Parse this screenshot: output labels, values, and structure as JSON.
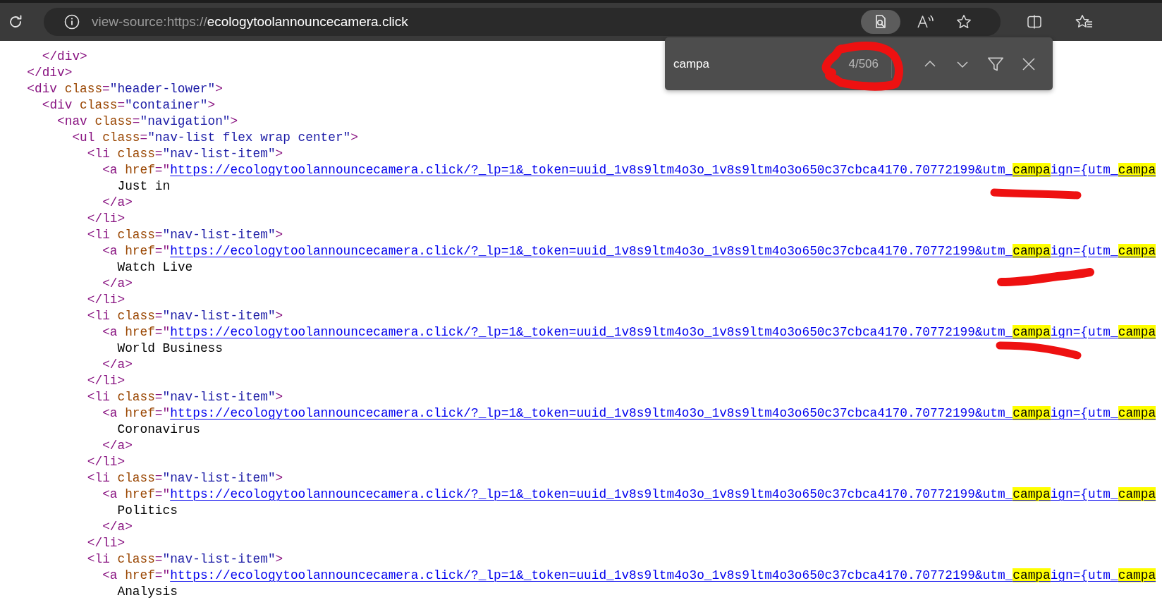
{
  "toolbar": {
    "address": {
      "scheme": "view-source:https://",
      "domain": "ecologytoolannouncecamera.click"
    },
    "find_button_active": true
  },
  "find_bar": {
    "query": "campa",
    "count": "4/506"
  },
  "source_lines": [
    {
      "children": [
        {
          "tokens": [
            {
              "kind": "tag",
              "text": "</div>"
            }
          ]
        }
      ]
    },
    {
      "tokens": [
        {
          "kind": "tag",
          "text": "</div>"
        }
      ]
    },
    {
      "tokens": [
        {
          "kind": "tag",
          "text": "<div "
        },
        {
          "kind": "attr",
          "text": "class"
        },
        {
          "kind": "tag",
          "text": "="
        },
        {
          "kind": "value",
          "text": "\"header-lower\""
        },
        {
          "kind": "tag",
          "text": ">"
        }
      ],
      "children": [
        {
          "tokens": [
            {
              "kind": "tag",
              "text": "<div "
            },
            {
              "kind": "attr",
              "text": "class"
            },
            {
              "kind": "tag",
              "text": "="
            },
            {
              "kind": "value",
              "text": "\"container\""
            },
            {
              "kind": "tag",
              "text": ">"
            }
          ],
          "children": [
            {
              "tokens": [
                {
                  "kind": "tag",
                  "text": "<nav "
                },
                {
                  "kind": "attr",
                  "text": "class"
                },
                {
                  "kind": "tag",
                  "text": "="
                },
                {
                  "kind": "value",
                  "text": "\"navigation\""
                },
                {
                  "kind": "tag",
                  "text": ">"
                }
              ],
              "children": [
                {
                  "tokens": [
                    {
                      "kind": "tag",
                      "text": "<ul "
                    },
                    {
                      "kind": "attr",
                      "text": "class"
                    },
                    {
                      "kind": "tag",
                      "text": "="
                    },
                    {
                      "kind": "value",
                      "text": "\"nav-list flex wrap center\""
                    },
                    {
                      "kind": "tag",
                      "text": ">"
                    }
                  ],
                  "children": [
                    {
                      "tokens": [
                        {
                          "kind": "tag",
                          "text": "<li "
                        },
                        {
                          "kind": "attr",
                          "text": "class"
                        },
                        {
                          "kind": "tag",
                          "text": "="
                        },
                        {
                          "kind": "value",
                          "text": "\"nav-list-item\""
                        },
                        {
                          "kind": "tag",
                          "text": ">"
                        }
                      ],
                      "children": [
                        {
                          "tokens": [
                            {
                              "kind": "tag",
                              "text": "<a "
                            },
                            {
                              "kind": "attr",
                              "text": "href"
                            },
                            {
                              "kind": "tag",
                              "text": "=\""
                            }
                          ],
                          "link": [
                            {
                              "text": "https://ecologytoolannouncecamera.click/?_lp=1&_token=uuid_1v8s9ltm4o3o_1v8s9ltm4o3o650c37cbca4170.70772199&utm_",
                              "match": false
                            },
                            {
                              "text": "campa",
                              "match": true
                            },
                            {
                              "text": "ign={utm_",
                              "match": false
                            },
                            {
                              "text": "campa",
                              "match": true
                            }
                          ],
                          "children": [
                            {
                              "tokens": [
                                {
                                  "kind": "text",
                                  "text": "Just in"
                                }
                              ]
                            }
                          ]
                        },
                        {
                          "tokens": [
                            {
                              "kind": "tag",
                              "text": "</a>"
                            }
                          ]
                        }
                      ]
                    },
                    {
                      "tokens": [
                        {
                          "kind": "tag",
                          "text": "</li>"
                        }
                      ]
                    },
                    {
                      "tokens": [
                        {
                          "kind": "tag",
                          "text": "<li "
                        },
                        {
                          "kind": "attr",
                          "text": "class"
                        },
                        {
                          "kind": "tag",
                          "text": "="
                        },
                        {
                          "kind": "value",
                          "text": "\"nav-list-item\""
                        },
                        {
                          "kind": "tag",
                          "text": ">"
                        }
                      ],
                      "children": [
                        {
                          "tokens": [
                            {
                              "kind": "tag",
                              "text": "<a "
                            },
                            {
                              "kind": "attr",
                              "text": "href"
                            },
                            {
                              "kind": "tag",
                              "text": "=\""
                            }
                          ],
                          "link": [
                            {
                              "text": "https://ecologytoolannouncecamera.click/?_lp=1&_token=uuid_1v8s9ltm4o3o_1v8s9ltm4o3o650c37cbca4170.70772199&utm_",
                              "match": false
                            },
                            {
                              "text": "campa",
                              "match": true
                            },
                            {
                              "text": "ign={utm_",
                              "match": false
                            },
                            {
                              "text": "campa",
                              "match": true
                            }
                          ],
                          "children": [
                            {
                              "tokens": [
                                {
                                  "kind": "text",
                                  "text": "Watch Live"
                                }
                              ]
                            }
                          ]
                        },
                        {
                          "tokens": [
                            {
                              "kind": "tag",
                              "text": "</a>"
                            }
                          ]
                        }
                      ]
                    },
                    {
                      "tokens": [
                        {
                          "kind": "tag",
                          "text": "</li>"
                        }
                      ]
                    },
                    {
                      "tokens": [
                        {
                          "kind": "tag",
                          "text": "<li "
                        },
                        {
                          "kind": "attr",
                          "text": "class"
                        },
                        {
                          "kind": "tag",
                          "text": "="
                        },
                        {
                          "kind": "value",
                          "text": "\"nav-list-item\""
                        },
                        {
                          "kind": "tag",
                          "text": ">"
                        }
                      ],
                      "children": [
                        {
                          "tokens": [
                            {
                              "kind": "tag",
                              "text": "<a "
                            },
                            {
                              "kind": "attr",
                              "text": "href"
                            },
                            {
                              "kind": "tag",
                              "text": "=\""
                            }
                          ],
                          "link": [
                            {
                              "text": "https://ecologytoolannouncecamera.click/?_lp=1&_token=uuid_1v8s9ltm4o3o_1v8s9ltm4o3o650c37cbca4170.70772199&utm_",
                              "match": false
                            },
                            {
                              "text": "campa",
                              "match": true
                            },
                            {
                              "text": "ign={utm_",
                              "match": false
                            },
                            {
                              "text": "campa",
                              "match": true
                            }
                          ],
                          "children": [
                            {
                              "tokens": [
                                {
                                  "kind": "text",
                                  "text": "World Business"
                                }
                              ]
                            }
                          ]
                        },
                        {
                          "tokens": [
                            {
                              "kind": "tag",
                              "text": "</a>"
                            }
                          ]
                        }
                      ]
                    },
                    {
                      "tokens": [
                        {
                          "kind": "tag",
                          "text": "</li>"
                        }
                      ]
                    },
                    {
                      "tokens": [
                        {
                          "kind": "tag",
                          "text": "<li "
                        },
                        {
                          "kind": "attr",
                          "text": "class"
                        },
                        {
                          "kind": "tag",
                          "text": "="
                        },
                        {
                          "kind": "value",
                          "text": "\"nav-list-item\""
                        },
                        {
                          "kind": "tag",
                          "text": ">"
                        }
                      ],
                      "children": [
                        {
                          "tokens": [
                            {
                              "kind": "tag",
                              "text": "<a "
                            },
                            {
                              "kind": "attr",
                              "text": "href"
                            },
                            {
                              "kind": "tag",
                              "text": "=\""
                            }
                          ],
                          "link": [
                            {
                              "text": "https://ecologytoolannouncecamera.click/?_lp=1&_token=uuid_1v8s9ltm4o3o_1v8s9ltm4o3o650c37cbca4170.70772199&utm_",
                              "match": false
                            },
                            {
                              "text": "campa",
                              "match": true
                            },
                            {
                              "text": "ign={utm_",
                              "match": false
                            },
                            {
                              "text": "campa",
                              "match": true
                            }
                          ],
                          "children": [
                            {
                              "tokens": [
                                {
                                  "kind": "text",
                                  "text": "Coronavirus"
                                }
                              ]
                            }
                          ]
                        },
                        {
                          "tokens": [
                            {
                              "kind": "tag",
                              "text": "</a>"
                            }
                          ]
                        }
                      ]
                    },
                    {
                      "tokens": [
                        {
                          "kind": "tag",
                          "text": "</li>"
                        }
                      ]
                    },
                    {
                      "tokens": [
                        {
                          "kind": "tag",
                          "text": "<li "
                        },
                        {
                          "kind": "attr",
                          "text": "class"
                        },
                        {
                          "kind": "tag",
                          "text": "="
                        },
                        {
                          "kind": "value",
                          "text": "\"nav-list-item\""
                        },
                        {
                          "kind": "tag",
                          "text": ">"
                        }
                      ],
                      "children": [
                        {
                          "tokens": [
                            {
                              "kind": "tag",
                              "text": "<a "
                            },
                            {
                              "kind": "attr",
                              "text": "href"
                            },
                            {
                              "kind": "tag",
                              "text": "=\""
                            }
                          ],
                          "link": [
                            {
                              "text": "https://ecologytoolannouncecamera.click/?_lp=1&_token=uuid_1v8s9ltm4o3o_1v8s9ltm4o3o650c37cbca4170.70772199&utm_",
                              "match": false
                            },
                            {
                              "text": "campa",
                              "match": true
                            },
                            {
                              "text": "ign={utm_",
                              "match": false
                            },
                            {
                              "text": "campa",
                              "match": true
                            }
                          ],
                          "children": [
                            {
                              "tokens": [
                                {
                                  "kind": "text",
                                  "text": "Politics"
                                }
                              ]
                            }
                          ]
                        },
                        {
                          "tokens": [
                            {
                              "kind": "tag",
                              "text": "</a>"
                            }
                          ]
                        }
                      ]
                    },
                    {
                      "tokens": [
                        {
                          "kind": "tag",
                          "text": "</li>"
                        }
                      ]
                    },
                    {
                      "tokens": [
                        {
                          "kind": "tag",
                          "text": "<li "
                        },
                        {
                          "kind": "attr",
                          "text": "class"
                        },
                        {
                          "kind": "tag",
                          "text": "="
                        },
                        {
                          "kind": "value",
                          "text": "\"nav-list-item\""
                        },
                        {
                          "kind": "tag",
                          "text": ">"
                        }
                      ],
                      "children": [
                        {
                          "tokens": [
                            {
                              "kind": "tag",
                              "text": "<a "
                            },
                            {
                              "kind": "attr",
                              "text": "href"
                            },
                            {
                              "kind": "tag",
                              "text": "=\""
                            }
                          ],
                          "link": [
                            {
                              "text": "https://ecologytoolannouncecamera.click/?_lp=1&_token=uuid_1v8s9ltm4o3o_1v8s9ltm4o3o650c37cbca4170.70772199&utm_",
                              "match": false
                            },
                            {
                              "text": "campa",
                              "match": true
                            },
                            {
                              "text": "ign={utm_",
                              "match": false
                            },
                            {
                              "text": "campa",
                              "match": true
                            }
                          ],
                          "children": [
                            {
                              "tokens": [
                                {
                                  "kind": "text",
                                  "text": "Analysis"
                                }
                              ]
                            }
                          ]
                        }
                      ]
                    }
                  ]
                }
              ]
            }
          ]
        }
      ]
    }
  ]
}
